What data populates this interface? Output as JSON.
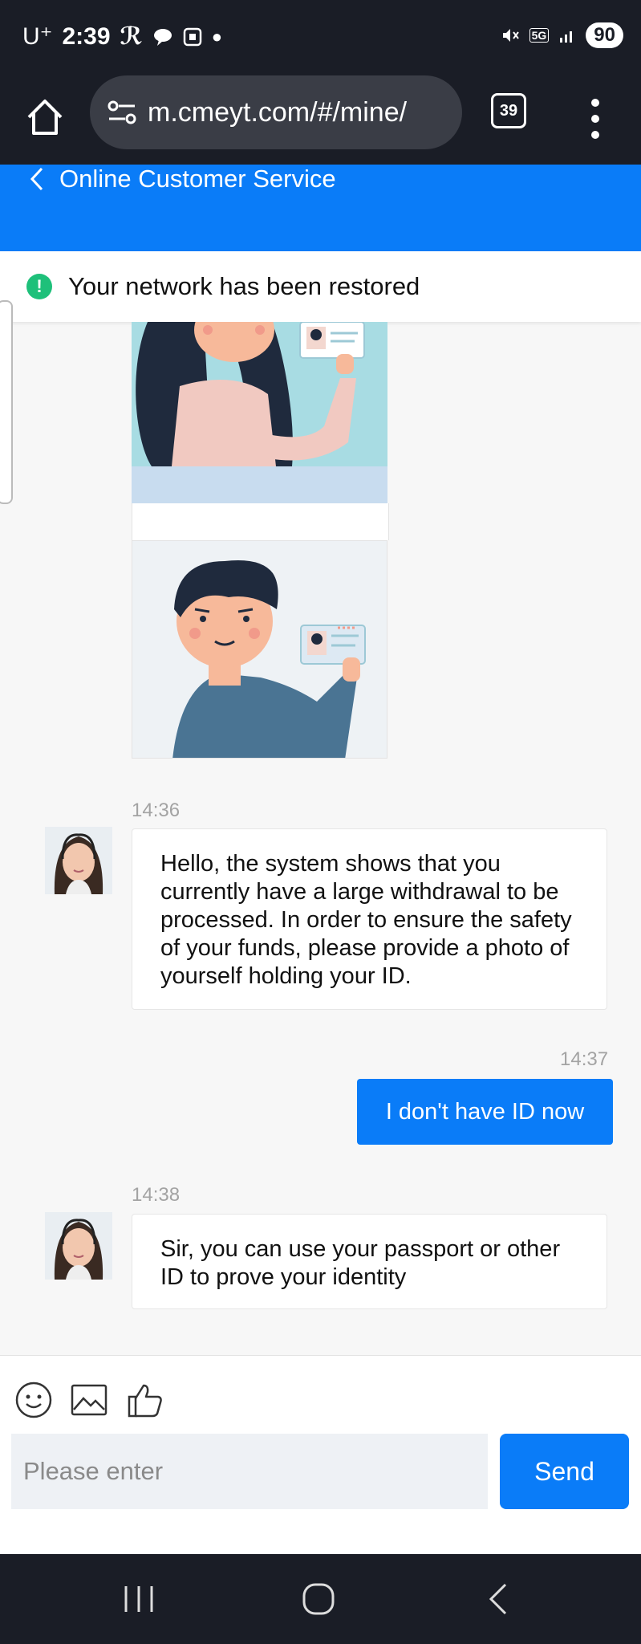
{
  "status_bar": {
    "carrier": "U⁺",
    "time": "2:39",
    "network": "5G",
    "battery": "90"
  },
  "browser": {
    "url": "m.cmeyt.com/#/mine/",
    "tab_count": "39"
  },
  "header": {
    "title": "Online Customer Service"
  },
  "network_banner": {
    "text": "Your network has been restored"
  },
  "messages": [
    {
      "time": "14:36",
      "direction": "incoming",
      "text": "Hello, the system shows that you currently have a large withdrawal to be processed. In order to ensure the safety of your funds, please provide a photo of yourself holding your ID."
    },
    {
      "time": "14:37",
      "direction": "outgoing",
      "text": "I don't have ID now"
    },
    {
      "time": "14:38",
      "direction": "incoming",
      "text": "Sir, you can use your passport or other ID to prove your identity"
    }
  ],
  "composer": {
    "placeholder": "Please enter",
    "send_label": "Send",
    "tools": [
      "smiley-icon",
      "image-icon",
      "thumbs-up-icon"
    ]
  },
  "colors": {
    "primary": "#0a7cf8",
    "success": "#1ec07a",
    "system_bar": "#1a1d26"
  }
}
